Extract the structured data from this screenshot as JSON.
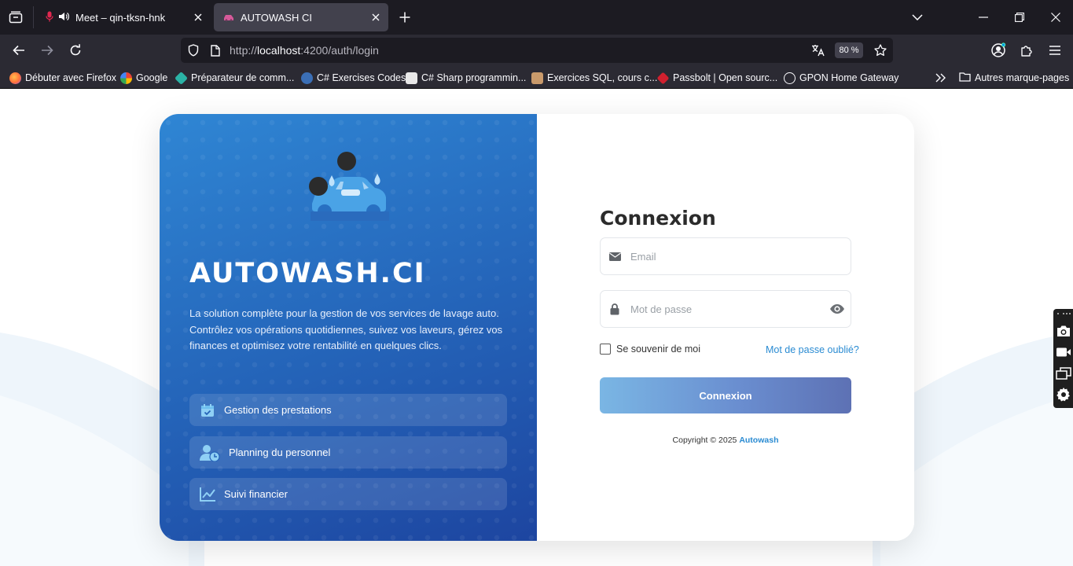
{
  "browser": {
    "tabs": [
      {
        "title": "Meet – qin-tksn-hnk"
      },
      {
        "title": "AUTOWASH CI"
      }
    ],
    "url": {
      "scheme": "http://",
      "host": "localhost",
      "rest": ":4200/auth/login"
    },
    "zoom": "80 %",
    "bookmarks": [
      {
        "label": "Débuter avec Firefox",
        "color": "#ff7139"
      },
      {
        "label": "Google",
        "color": "#ffffff"
      },
      {
        "label": "Préparateur de comm...",
        "color": "#2bb3a6"
      },
      {
        "label": "C# Exercises Codes",
        "color": "#3b6fb6"
      },
      {
        "label": "C# Sharp programmin...",
        "color": "#e8e8e8"
      },
      {
        "label": "Exercices SQL, cours c...",
        "color": "#c99a6b"
      },
      {
        "label": "Passbolt | Open sourc...",
        "color": "#d0202e"
      },
      {
        "label": "GPON Home Gateway",
        "color": "#fbfbfe"
      }
    ],
    "other_bookmarks": "Autres marque-pages"
  },
  "hero": {
    "brand": "AUTOWASH.CI",
    "description": "La solution complète pour la gestion de vos services de lavage auto. Contrôlez vos opérations quotidiennes, suivez vos laveurs, gérez vos finances et optimisez votre rentabilité en quelques clics.",
    "features": [
      {
        "label": "Gestion des prestations",
        "icon": "calendar-check-icon"
      },
      {
        "label": "Planning du personnel",
        "icon": "user-clock-icon"
      },
      {
        "label": "Suivi financier",
        "icon": "chart-line-icon"
      }
    ]
  },
  "login": {
    "title": "Connexion",
    "email_placeholder": "Email",
    "password_placeholder": "Mot de passe",
    "remember_label": "Se souvenir de moi",
    "forgot_label": "Mot de passe oublié?",
    "submit_label": "Connexion",
    "copyright_prefix": "Copyright © 2025",
    "copyright_brand": "Autowash"
  },
  "colors": {
    "accent": "#2a8bd2",
    "hero_start": "#2f86d4",
    "hero_end": "#1d45a0"
  }
}
